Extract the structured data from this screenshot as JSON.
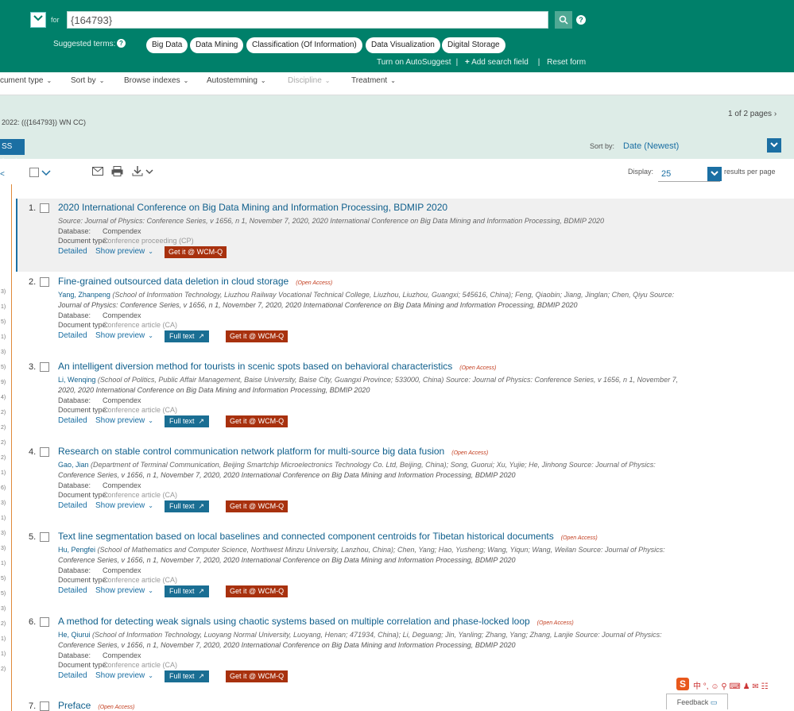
{
  "search": {
    "for_label": "for",
    "value": "{164793}",
    "suggested_label": "Suggested terms:",
    "suggested_terms": [
      "Big Data",
      "Data Mining",
      "Classification (Of Information)",
      "Data Visualization",
      "Digital Storage"
    ],
    "links": [
      "Turn on AutoSuggest",
      "Add search field",
      "Reset form"
    ]
  },
  "toolbar": {
    "items": [
      "cument type",
      "Sort by",
      "Browse indexes",
      "Autostemming",
      "Discipline",
      "Treatment"
    ]
  },
  "results_header": {
    "query_text": "2022: (({164793}) WN CC)",
    "pages": "1 of 2 pages",
    "rss_label": "SS feed",
    "sort_label": "Sort by:",
    "sort_value": "Date (Newest)",
    "display_label": "Display:",
    "display_value": "25",
    "results_per_page": "results per page"
  },
  "left_strip_numbers": [
    "3)",
    "1)",
    "5)",
    "1)",
    "3)",
    "5)",
    "9)",
    "4)",
    "2)",
    "2)",
    "2)",
    "2)",
    "1)",
    "6)",
    "3)",
    "1)",
    "3)",
    "3)",
    "1)",
    "5)",
    "5)",
    "3)",
    "2)",
    "1)",
    "1)",
    "2)"
  ],
  "labels": {
    "source": "Source:",
    "database": "Database:",
    "doctype": "Document type:",
    "detailed": "Detailed",
    "show_preview": "Show preview",
    "full_text": "Full text",
    "get_it": "Get it @ WCM-Q",
    "open_access": "(Open Access)"
  },
  "results": [
    {
      "num": "1.",
      "title": "2020 International Conference on Big Data Mining and Information Processing, BDMIP 2020",
      "open_access": false,
      "line1_authors": "",
      "line1_rest": "Source: Journal of Physics: Conference Series, v 1656, n 1, November 7, 2020, 2020 International Conference on Big Data Mining and Information Processing, BDMIP 2020",
      "line2": "",
      "database": "Compendex",
      "doctype": "Conference proceeding (CP)",
      "full_text": false
    },
    {
      "num": "2.",
      "title": "Fine-grained outsourced data deletion in cloud storage",
      "open_access": true,
      "line1_authors": "Yang, Zhanpeng",
      "line1_rest": "(School of Information Technology, Liuzhou Railway Vocational Technical College, Liuzhou, Liuzhou, Guangxi; 545616, China); Feng, Qiaobin; Jiang, Jinglan; Chen, Qiyu Source:",
      "line2": "Journal of Physics: Conference Series, v 1656, n 1, November 7, 2020, 2020 International Conference on Big Data Mining and Information Processing, BDMIP 2020",
      "database": "Compendex",
      "doctype": "Conference article (CA)",
      "full_text": true
    },
    {
      "num": "3.",
      "title": "An intelligent diversion method for tourists in scenic spots based on behavioral characteristics",
      "open_access": true,
      "line1_authors": "Li, Wenqing",
      "line1_rest": "(School of Politics, Public Affair Management, Baise University, Baise City, Guangxi Province; 533000, China) Source: Journal of Physics: Conference Series, v 1656, n 1, November 7,",
      "line2": "2020, 2020 International Conference on Big Data Mining and Information Processing, BDMIP 2020",
      "database": "Compendex",
      "doctype": "Conference article (CA)",
      "full_text": true
    },
    {
      "num": "4.",
      "title": "Research on stable control communication network platform for multi-source big data fusion",
      "open_access": true,
      "line1_authors": "Gao, Jian",
      "line1_rest": "(Department of Terminal Communication, Beijing Smartchip Microelectronics Technology Co. Ltd, Beijing, China); Song, Guorui; Xu, Yujie; He, Jinhong Source: Journal of Physics:",
      "line2": "Conference Series, v 1656, n 1, November 7, 2020, 2020 International Conference on Big Data Mining and Information Processing, BDMIP 2020",
      "database": "Compendex",
      "doctype": "Conference article (CA)",
      "full_text": true
    },
    {
      "num": "5.",
      "title": "Text line segmentation based on local baselines and connected component centroids for Tibetan historical documents",
      "open_access": true,
      "line1_authors": "Hu, Pengfei",
      "line1_rest": "(School of Mathematics and Computer Science, Northwest Minzu University, Lanzhou, China); Chen, Yang; Hao, Yusheng; Wang, Yiqun; Wang, Weilan Source: Journal of Physics:",
      "line2": "Conference Series, v 1656, n 1, November 7, 2020, 2020 International Conference on Big Data Mining and Information Processing, BDMIP 2020",
      "database": "Compendex",
      "doctype": "Conference article (CA)",
      "full_text": true
    },
    {
      "num": "6.",
      "title": "A method for detecting weak signals using chaotic systems based on multiple correlation and phase-locked loop",
      "open_access": true,
      "line1_authors": "He, Qiurui",
      "line1_rest": "(School of Information Technology, Luoyang Normal University, Luoyang, Henan; 471934, China); Li, Deguang; Jin, Yanling; Zhang, Yang; Zhang, Lanjie Source: Journal of Physics:",
      "line2": "Conference Series, v 1656, n 1, November 7, 2020, 2020 International Conference on Big Data Mining and Information Processing, BDMIP 2020",
      "database": "Compendex",
      "doctype": "Conference article (CA)",
      "full_text": true
    },
    {
      "num": "7.",
      "title": "Preface",
      "open_access": true,
      "line1_authors": "",
      "line1_rest": "",
      "line2": "",
      "database": "",
      "doctype": "",
      "full_text": false
    }
  ],
  "tray": {
    "text": "中 °, ☺ ⚲ ⌨ ♟ ✉ ☷"
  },
  "feedback": {
    "label": "Feedback"
  }
}
